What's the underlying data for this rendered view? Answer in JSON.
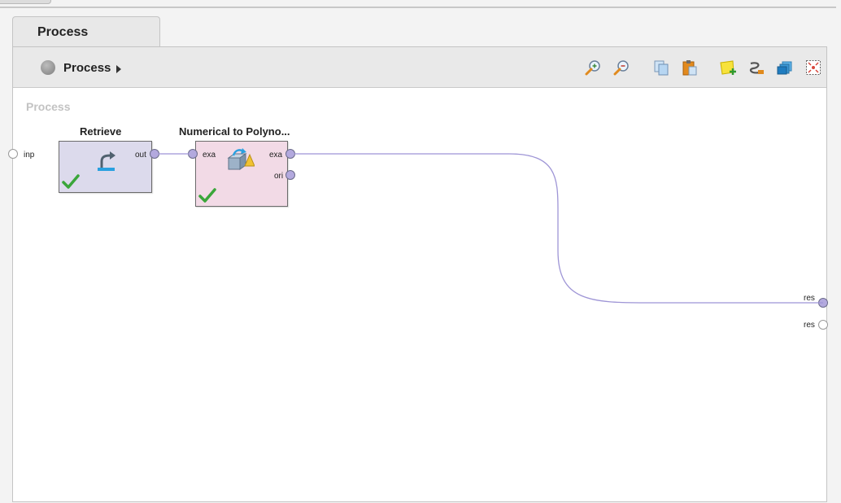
{
  "tab": {
    "label": "Process"
  },
  "toolbar": {
    "breadcrumb_label": "Process",
    "icons": [
      "zoom-in-icon",
      "zoom-out-icon",
      "copy-icon",
      "paste-icon",
      "add-note-icon",
      "auto-wire-icon",
      "layers-icon",
      "fit-view-icon"
    ]
  },
  "canvas": {
    "title": "Process",
    "left_port_label": "inp",
    "right_port_labels": [
      "res",
      "res"
    ]
  },
  "operators": [
    {
      "title": "Retrieve",
      "status": "ok",
      "ports_out": [
        "out"
      ],
      "ports_in": []
    },
    {
      "title": "Numerical to Polyno...",
      "status": "ok",
      "ports_in": [
        "exa"
      ],
      "ports_out": [
        "exa",
        "ori"
      ]
    }
  ],
  "colors": {
    "wire": "#9e95d6",
    "retrieve_fill": "#dcdaec",
    "poly_fill": "#f2dae6",
    "check_green": "#3aa63a"
  }
}
